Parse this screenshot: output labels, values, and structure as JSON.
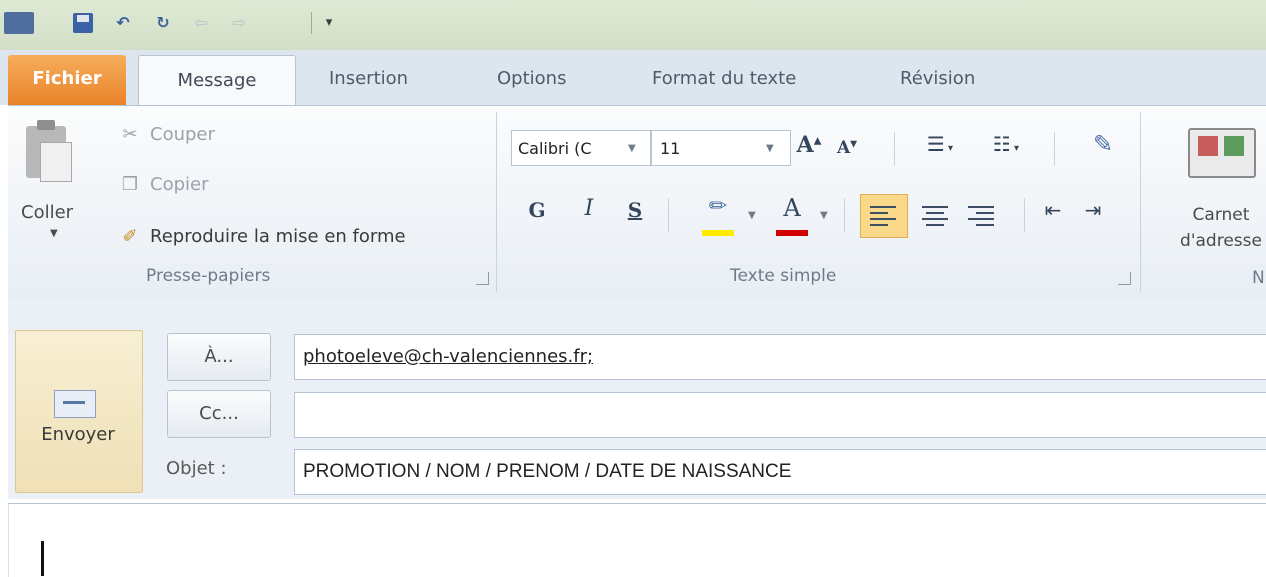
{
  "tabs": {
    "file": "Fichier",
    "message": "Message",
    "insertion": "Insertion",
    "options": "Options",
    "format": "Format du texte",
    "revision": "Révision"
  },
  "clipboard": {
    "paste": "Coller",
    "cut": "Couper",
    "copy": "Copier",
    "format_painter": "Reproduire la mise en forme",
    "group_label": "Presse-papiers"
  },
  "basic_text": {
    "font_name": "Calibri (C",
    "font_size": "11",
    "bold": "G",
    "italic": "I",
    "underline": "S",
    "group_label": "Texte simple"
  },
  "names": {
    "address_book_line1": "Carnet",
    "address_book_line2": "d'adresse",
    "group_label_partial": "N"
  },
  "compose": {
    "send_label": "Envoyer",
    "to_button": "À...",
    "cc_button": "Cc...",
    "subject_label": "Objet :",
    "to_value": "photoeleve@ch-valenciennes.fr;",
    "cc_value": "",
    "subject_value": "PROMOTION / NOM / PRENOM / DATE DE NAISSANCE"
  },
  "colors": {
    "file_tab": "#e9832a",
    "send_button": "#efe0b6",
    "active_align": "#fbd98a",
    "highlight_yellow": "#ffec00",
    "font_red": "#d10000"
  }
}
